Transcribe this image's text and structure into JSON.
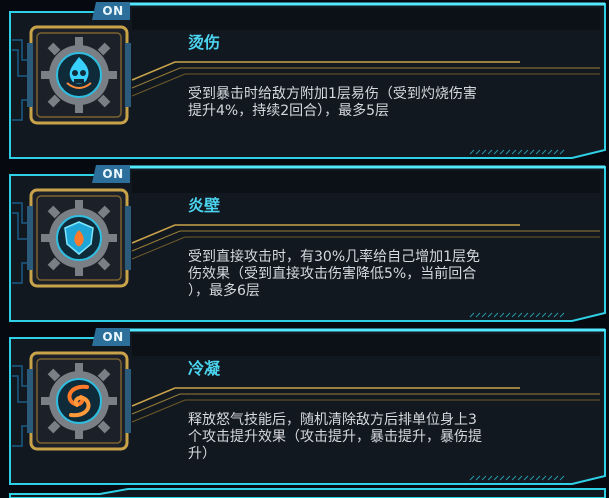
{
  "colors": {
    "frame_cyan": "#2fd0e6",
    "gold": "#c9a34a",
    "title_cyan": "#4ad4ef",
    "body_text": "#d5d9de",
    "panel_bg": "#141a22"
  },
  "skills": [
    {
      "badge": "ON",
      "title": "烫伤",
      "icon": "burn-skull-gear-icon",
      "desc_lines": [
        "受到暴击时给敌方附加1层易伤（受到灼烧伤害",
        "提升4%，持续2回合），最多5层"
      ]
    },
    {
      "badge": "ON",
      "title": "炎壁",
      "icon": "fire-wall-shield-gear-icon",
      "desc_lines": [
        "受到直接攻击时，有30%几率给自己增加1层免",
        "伤效果（受到直接攻击伤害降低5%，当前回合",
        "），最多6层"
      ]
    },
    {
      "badge": "ON",
      "title": "冷凝",
      "icon": "condense-swirl-gear-icon",
      "desc_lines": [
        "释放怒气技能后，随机清除敌方后排单位身上3",
        "个攻击提升效果（攻击提升，暴击提升，暴伤提",
        "升）"
      ]
    }
  ]
}
